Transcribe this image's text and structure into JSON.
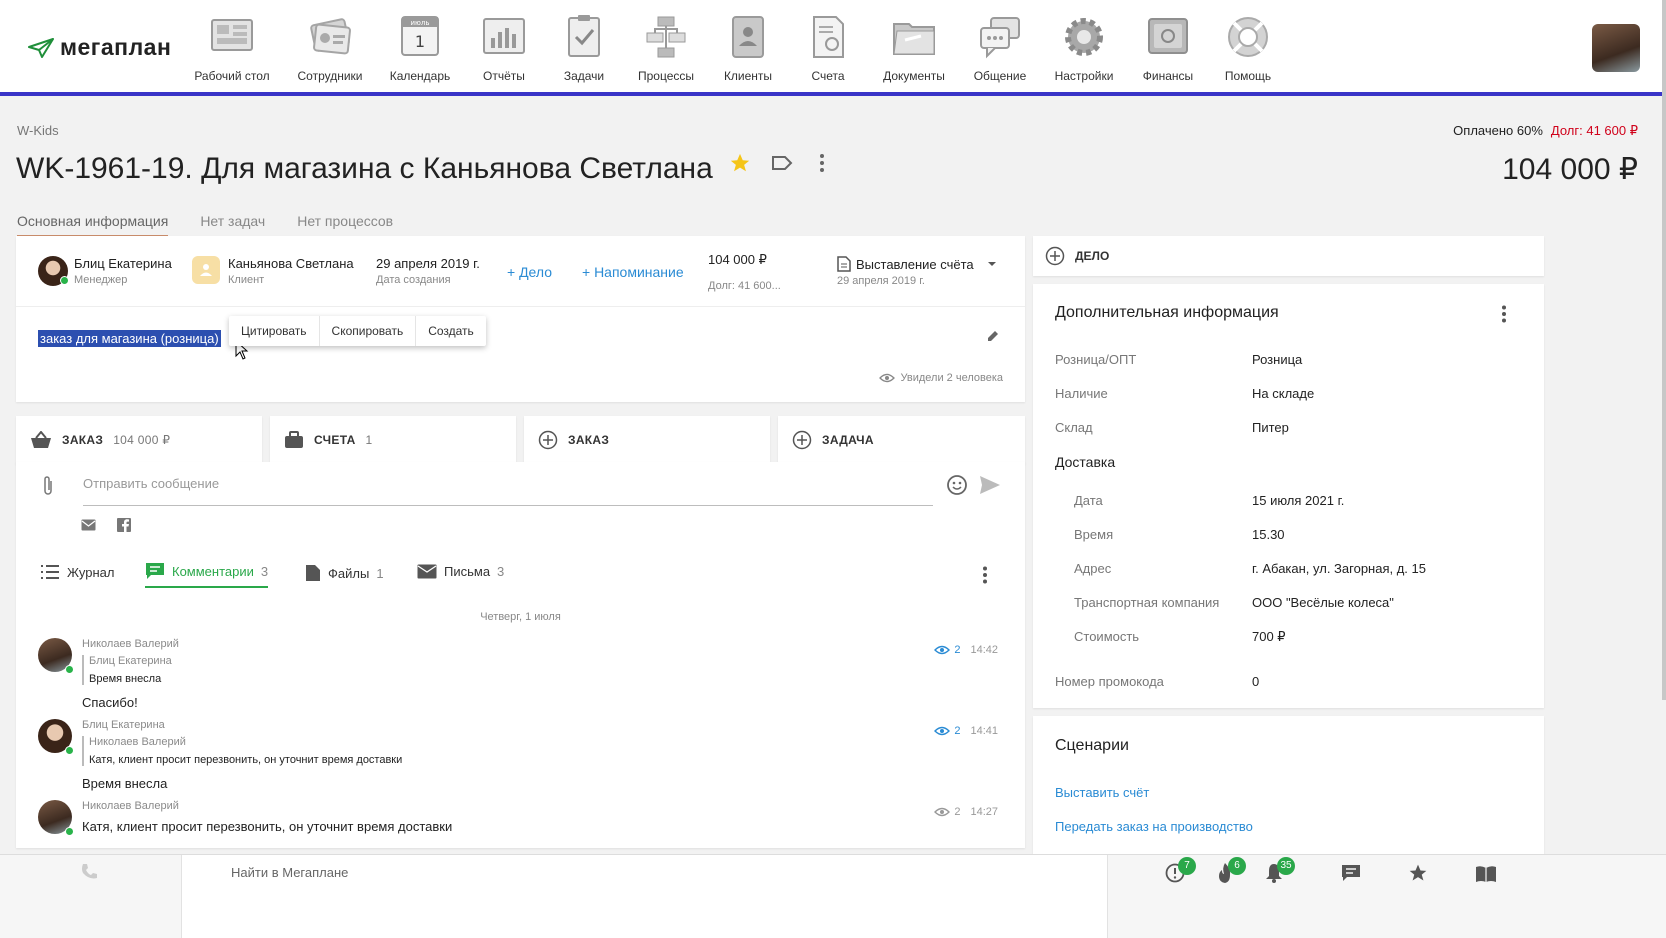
{
  "header": {
    "logo_text": "мегаплан",
    "nav": [
      {
        "label": "Рабочий стол",
        "icon": "desktop-icon"
      },
      {
        "label": "Сотрудники",
        "icon": "employees-icon"
      },
      {
        "label": "Календарь",
        "icon": "calendar-icon",
        "icon_month": "июль",
        "icon_day": "1"
      },
      {
        "label": "Отчёты",
        "icon": "reports-icon"
      },
      {
        "label": "Задачи",
        "icon": "tasks-icon"
      },
      {
        "label": "Процессы",
        "icon": "processes-icon"
      },
      {
        "label": "Клиенты",
        "icon": "clients-icon"
      },
      {
        "label": "Счета",
        "icon": "invoices-icon"
      },
      {
        "label": "Документы",
        "icon": "documents-icon"
      },
      {
        "label": "Общение",
        "icon": "chat-icon"
      },
      {
        "label": "Настройки",
        "icon": "settings-icon"
      },
      {
        "label": "Финансы",
        "icon": "finance-icon"
      },
      {
        "label": "Помощь",
        "icon": "help-icon"
      }
    ]
  },
  "deal": {
    "breadcrumb": "W-Kids",
    "title": "WK-1961-19. Для магазина с Каньянова Светлана",
    "paid": "Оплачено 60%",
    "debt": "Долг: 41 600 ₽",
    "amount": "104 000 ₽",
    "tabs": [
      "Основная информация",
      "Нет задач",
      "Нет процессов"
    ]
  },
  "info_card": {
    "manager_name": "Блиц Екатерина",
    "manager_role": "Менеджер",
    "client_name": "Каньянова Светлана",
    "client_role": "Клиент",
    "date": "29 апреля 2019 г.",
    "date_label": "Дата создания",
    "add_deal": "+ Дело",
    "add_reminder": "+ Напоминание",
    "sum": "104 000 ₽",
    "sum_debt": "Долг: 41 600...",
    "stage": "Выставление счёта",
    "stage_date": "29 апреля 2019 г.",
    "description": "заказ для магазина (розница)",
    "seen": "Увидели 2 человека",
    "context_menu": [
      "Цитировать",
      "Скопировать",
      "Создать"
    ]
  },
  "actions": [
    {
      "label": "ЗАКАЗ",
      "count": "104 000 ₽"
    },
    {
      "label": "СЧЕТА",
      "count": "1"
    },
    {
      "label": "ЗАКАЗ",
      "count": ""
    },
    {
      "label": "ЗАДАЧА",
      "count": ""
    }
  ],
  "messenger": {
    "placeholder": "Отправить сообщение",
    "tabs": [
      {
        "label": "Журнал",
        "count": ""
      },
      {
        "label": "Комментарии",
        "count": "3"
      },
      {
        "label": "Файлы",
        "count": "1"
      },
      {
        "label": "Письма",
        "count": "3"
      }
    ],
    "date_divider": "Четверг, 1 июля",
    "messages": [
      {
        "author": "Николаев Валерий",
        "quote_author": "Блиц Екатерина",
        "quote_text": "Время внесла",
        "text": "Спасибо!",
        "views": "2",
        "time": "14:42"
      },
      {
        "author": "Блиц Екатерина",
        "quote_author": "Николаев Валерий",
        "quote_text": "Катя, клиент просит перезвонить, он уточнит время доставки",
        "text": "Время внесла",
        "views": "2",
        "time": "14:41"
      },
      {
        "author": "Николаев Валерий",
        "quote_author": "",
        "quote_text": "",
        "text": "Катя, клиент просит перезвонить, он уточнит время доставки",
        "views": "2",
        "time": "14:27"
      }
    ]
  },
  "right": {
    "add_deal": "ДЕЛО",
    "info_title": "Дополнительная информация",
    "fields": [
      {
        "label": "Розница/ОПТ",
        "value": "Розница"
      },
      {
        "label": "Наличие",
        "value": "На складе"
      },
      {
        "label": "Склад",
        "value": "Питер"
      }
    ],
    "delivery_title": "Доставка",
    "delivery": [
      {
        "label": "Дата",
        "value": "15 июля 2021 г."
      },
      {
        "label": "Время",
        "value": "15.30"
      },
      {
        "label": "Адрес",
        "value": "г. Абакан, ул. Загорная, д. 15"
      },
      {
        "label": "Транспортная компания",
        "value": "ООО \"Весёлые колеса\""
      },
      {
        "label": "Стоимость",
        "value": "700 ₽"
      }
    ],
    "promo_label": "Номер промокода",
    "promo_value": "0",
    "scenarios_title": "Сценарии",
    "scenarios": [
      "Выставить счёт",
      "Передать заказ на производство"
    ]
  },
  "bottom": {
    "search_placeholder": "Найти в Мегаплане",
    "badges": {
      "alerts": "7",
      "fire": "6",
      "bell": "35"
    }
  },
  "colors": {
    "accent": "#3a35c8",
    "link": "#2a8bd4",
    "green": "#2aa84a",
    "debt": "#d0021b",
    "star": "#f5c518"
  }
}
